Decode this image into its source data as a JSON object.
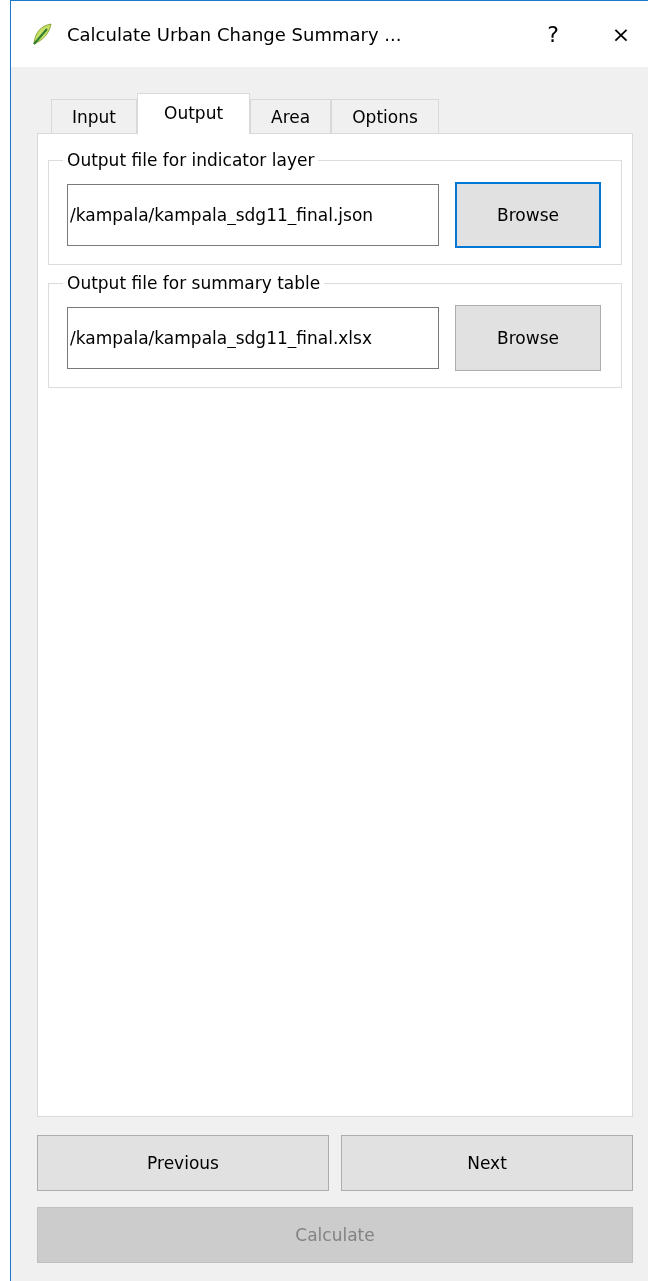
{
  "window": {
    "title": "Calculate Urban Change Summary ...",
    "help": "?",
    "close": "×"
  },
  "tabs": [
    {
      "label": "Input",
      "selected": false
    },
    {
      "label": "Output",
      "selected": true
    },
    {
      "label": "Area",
      "selected": false
    },
    {
      "label": "Options",
      "selected": false
    }
  ],
  "groups": [
    {
      "legend": "Output file for indicator layer",
      "value": "/kampala/kampala_sdg11_final.json",
      "button": {
        "label": "Browse",
        "focused": true
      }
    },
    {
      "legend": "Output file for summary table",
      "value": "/kampala/kampala_sdg11_final.xlsx",
      "button": {
        "label": "Browse",
        "focused": false
      }
    }
  ],
  "nav_buttons": [
    {
      "label": "Previous",
      "disabled": false
    },
    {
      "label": "Next",
      "disabled": false
    }
  ],
  "calculate_button": {
    "label": "Calculate",
    "disabled": true
  }
}
